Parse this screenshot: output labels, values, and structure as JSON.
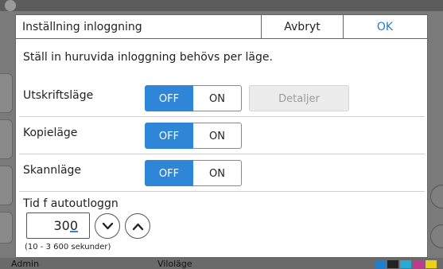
{
  "background": {
    "user_label": "Admin",
    "mode_label": "Viloläge"
  },
  "dialog": {
    "title": "Inställning inloggning",
    "cancel_label": "Avbryt",
    "ok_label": "OK",
    "description": "Ställ in huruvida inloggning behövs per läge."
  },
  "rows": [
    {
      "label": "Utskriftsläge",
      "off_label": "OFF",
      "on_label": "ON",
      "selected": "OFF",
      "details_label": "Detaljer",
      "details_enabled": false
    },
    {
      "label": "Kopieläge",
      "off_label": "OFF",
      "on_label": "ON",
      "selected": "OFF"
    },
    {
      "label": "Skannläge",
      "off_label": "OFF",
      "on_label": "ON",
      "selected": "OFF"
    }
  ],
  "timeout": {
    "label": "Tid f autoutloggn",
    "value": "300",
    "range_text": "(10 - 3 600 sekunder)",
    "decrease_icon": "chevron-down-icon",
    "increase_icon": "chevron-up-icon"
  },
  "colors": {
    "accent": "#2f86d6",
    "ok_text": "#1f7ecf"
  }
}
